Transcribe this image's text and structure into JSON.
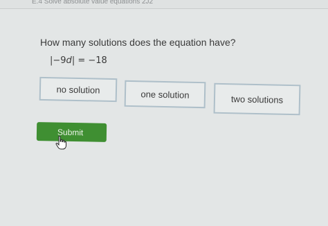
{
  "header": {
    "breadcrumb": "E.4 Solve absolute value equations  2J2"
  },
  "question": {
    "prompt": "How many solutions does the equation have?",
    "equation": {
      "left_open": "|−9",
      "variable": "d",
      "left_close": "|",
      "equals": " = ",
      "right": "−18"
    }
  },
  "choices": [
    {
      "label": "no solution"
    },
    {
      "label": "one solution"
    },
    {
      "label": "two solutions"
    }
  ],
  "actions": {
    "submit_label": "Submit"
  },
  "colors": {
    "submit_bg": "#3f8f32",
    "choice_border": "#aebfc9",
    "background": "#e3e6e6"
  },
  "icons": {
    "cursor": "hand-pointer-icon"
  }
}
